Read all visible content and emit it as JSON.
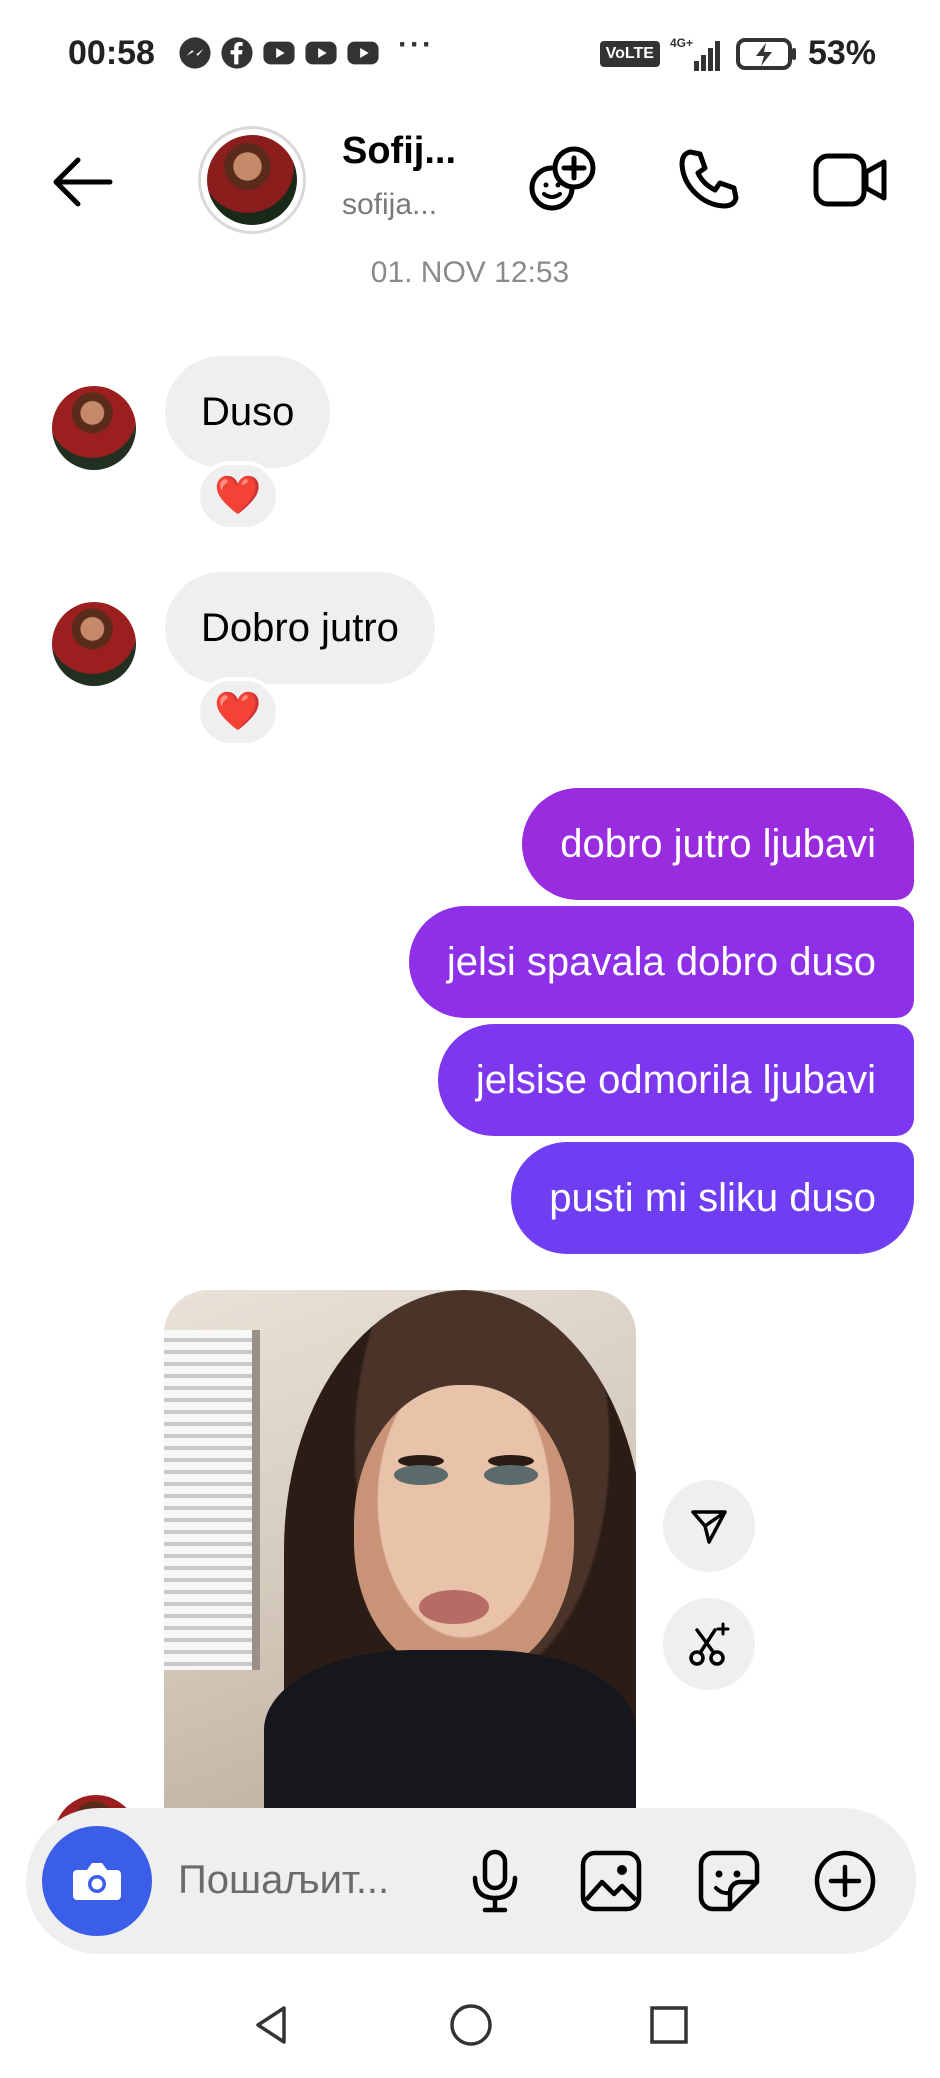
{
  "status_bar": {
    "time": "00:58",
    "more": "···",
    "network_badge": "VoLTE",
    "network_type": "4G+",
    "battery": "53%"
  },
  "header": {
    "contact_name": "Sofij...",
    "contact_username": "sofija..."
  },
  "date_separator": "01. NOV 12:53",
  "incoming": [
    {
      "text": "Duso",
      "reaction": "❤️"
    },
    {
      "text": "Dobro jutro",
      "reaction": "❤️"
    }
  ],
  "outgoing": [
    {
      "text": "dobro jutro ljubavi"
    },
    {
      "text": "jelsi spavala dobro  duso"
    },
    {
      "text": "jelsise odmorila ljubavi"
    },
    {
      "text": "pusti mi sliku duso"
    }
  ],
  "composer": {
    "placeholder": "Пошаљит..."
  },
  "colors": {
    "accent_camera": "#3b5ee8",
    "bubble_in": "#efefef",
    "bubble_out_top": "#9a2ce0",
    "bubble_out_bottom": "#6f3ef2"
  },
  "icons": {
    "back": "arrow-left-icon",
    "group_add": "add-people-icon",
    "call": "phone-icon",
    "video": "video-camera-icon",
    "share": "send-icon",
    "remix": "scissors-sparkle-icon",
    "mic": "microphone-icon",
    "gallery": "image-icon",
    "sticker": "sticker-icon",
    "plus": "plus-circle-icon"
  }
}
